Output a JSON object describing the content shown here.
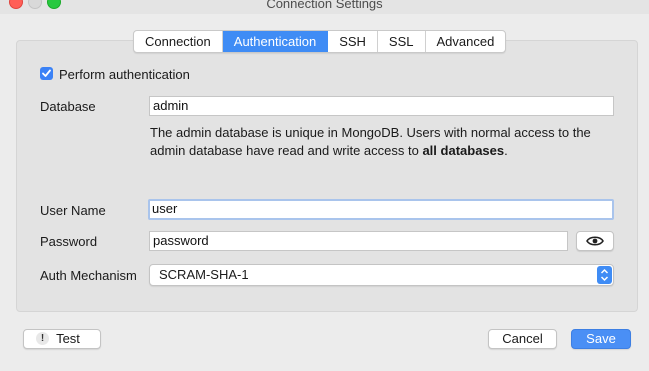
{
  "window": {
    "title": "Connection Settings"
  },
  "tabs": [
    {
      "label": "Connection"
    },
    {
      "label": "Authentication"
    },
    {
      "label": "SSH"
    },
    {
      "label": "SSL"
    },
    {
      "label": "Advanced"
    }
  ],
  "active_tab": "Authentication",
  "auth": {
    "perform_label": "Perform authentication",
    "perform_checked": true,
    "database_label": "Database",
    "database_value": "admin",
    "help_part1": "The admin database is unique in MongoDB. Users with normal access to the admin database have read and write access to ",
    "help_bold": "all databases",
    "help_part2": ".",
    "username_label": "User Name",
    "username_value": "user",
    "password_label": "Password",
    "password_value": "password",
    "mechanism_label": "Auth Mechanism",
    "mechanism_value": "SCRAM-SHA-1"
  },
  "footer": {
    "test_label": "Test",
    "test_icon_glyph": "!",
    "cancel_label": "Cancel",
    "save_label": "Save"
  },
  "colors": {
    "accent": "#3f8cf5",
    "primary_button": "#4a8ff5",
    "close": "#ff5f57",
    "zoom": "#28c940"
  },
  "icons": {
    "show_password": "eye-icon",
    "test_button": "warning-icon",
    "select": "updown-chevron-icon"
  }
}
